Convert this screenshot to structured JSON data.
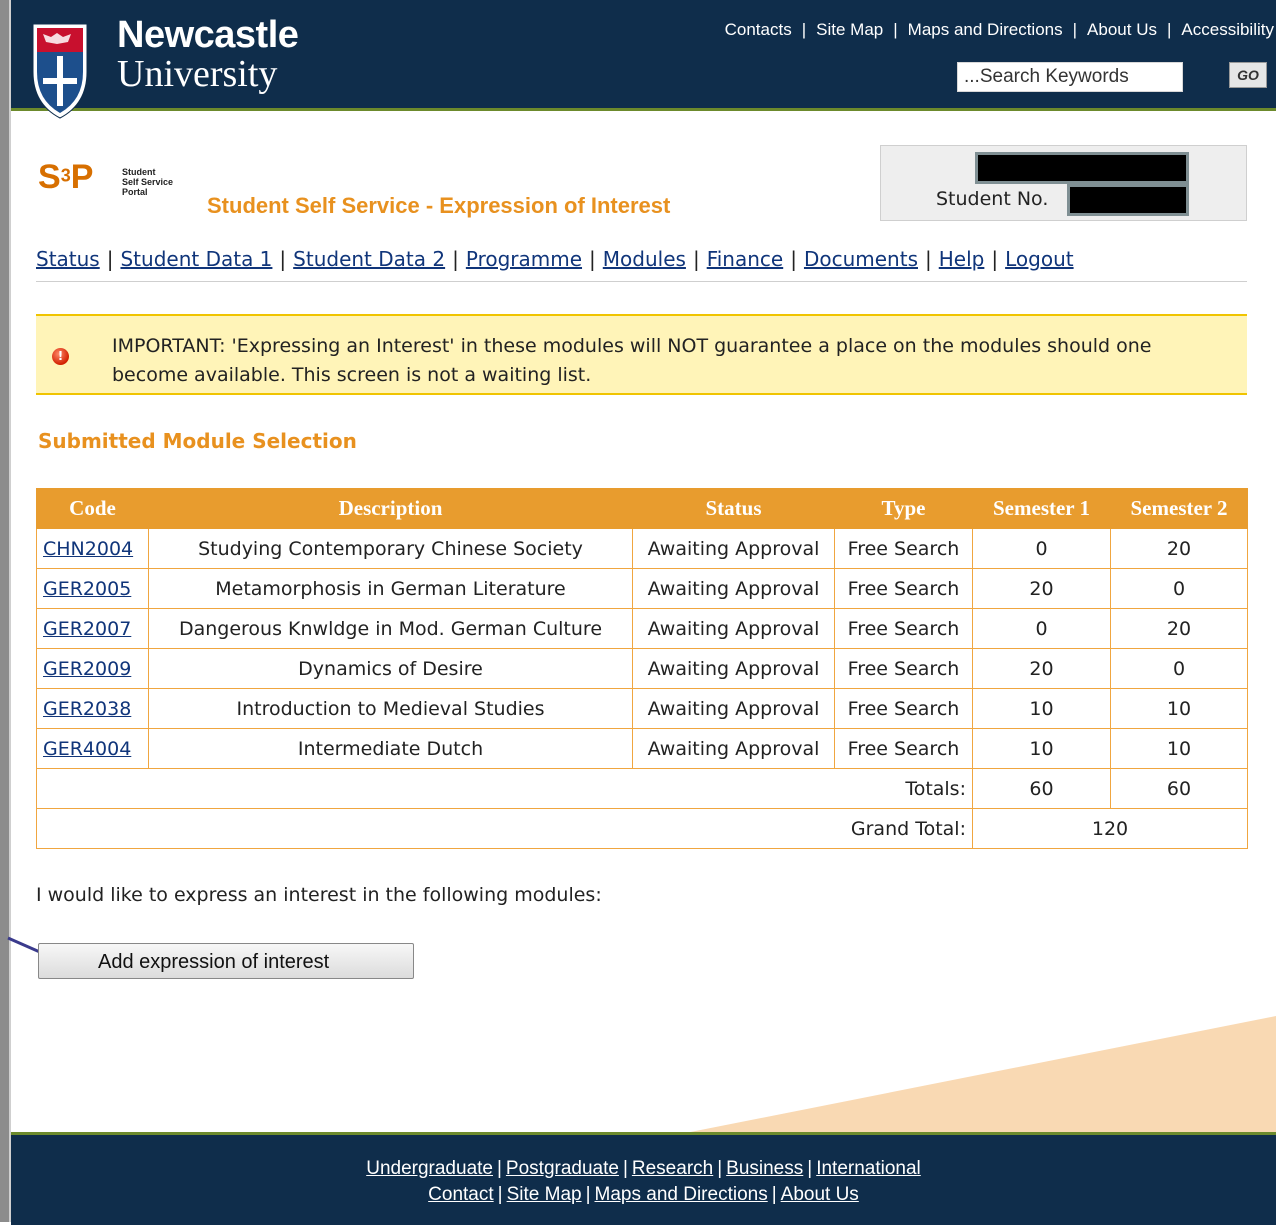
{
  "header": {
    "logo_line1": "Newcastle",
    "logo_line2": "University",
    "top_links": [
      "Contacts",
      "Site Map",
      "Maps and Directions",
      "About Us",
      "Accessibility"
    ],
    "search_placeholder": "...Search Keywords",
    "go_label": "GO"
  },
  "portal": {
    "logo_letters": "S",
    "logo_superscript": "3",
    "logo_p": "P",
    "logo_small": "Student\nSelf Service\nPortal",
    "title": "Student Self Service - Expression of Interest",
    "student_no_label": "Student No."
  },
  "nav": {
    "items": [
      "Status",
      "Student Data 1",
      "Student Data 2",
      "Programme",
      "Modules",
      "Finance",
      "Documents",
      "Help",
      "Logout"
    ]
  },
  "notice": {
    "icon": "alert-icon",
    "text": "IMPORTANT: 'Expressing an Interest' in these modules will NOT guarantee a place on the modules should one become available. This screen is not a waiting list."
  },
  "section_heading": "Submitted Module Selection",
  "table": {
    "headers": [
      "Code",
      "Description",
      "Status",
      "Type",
      "Semester 1",
      "Semester 2"
    ],
    "rows": [
      {
        "code": "CHN2004",
        "description": "Studying Contemporary Chinese Society",
        "status": "Awaiting Approval",
        "type": "Free Search",
        "sem1": "0",
        "sem2": "20"
      },
      {
        "code": "GER2005",
        "description": "Metamorphosis in German Literature",
        "status": "Awaiting Approval",
        "type": "Free Search",
        "sem1": "20",
        "sem2": "0"
      },
      {
        "code": "GER2007",
        "description": "Dangerous Knwldge in Mod. German Culture",
        "status": "Awaiting Approval",
        "type": "Free Search",
        "sem1": "0",
        "sem2": "20"
      },
      {
        "code": "GER2009",
        "description": "Dynamics of Desire",
        "status": "Awaiting Approval",
        "type": "Free Search",
        "sem1": "20",
        "sem2": "0"
      },
      {
        "code": "GER2038",
        "description": "Introduction to Medieval Studies",
        "status": "Awaiting Approval",
        "type": "Free Search",
        "sem1": "10",
        "sem2": "10"
      },
      {
        "code": "GER4004",
        "description": "Intermediate Dutch",
        "status": "Awaiting Approval",
        "type": "Free Search",
        "sem1": "10",
        "sem2": "10"
      }
    ],
    "totals_label": "Totals:",
    "totals_sem1": "60",
    "totals_sem2": "60",
    "grand_total_label": "Grand Total:",
    "grand_total": "120"
  },
  "express_text": "I would like to express an interest in the following modules:",
  "add_button_label": "Add expression of interest",
  "footer": {
    "row1": [
      "Undergraduate",
      "Postgraduate",
      "Research",
      "Business",
      "International"
    ],
    "row2": [
      "Contact",
      "Site Map",
      "Maps and Directions",
      "About Us"
    ]
  },
  "colors": {
    "header_bg": "#0f2d4b",
    "accent_orange": "#e89c2e",
    "title_orange": "#e8911f",
    "notice_bg": "#fff4b8"
  }
}
